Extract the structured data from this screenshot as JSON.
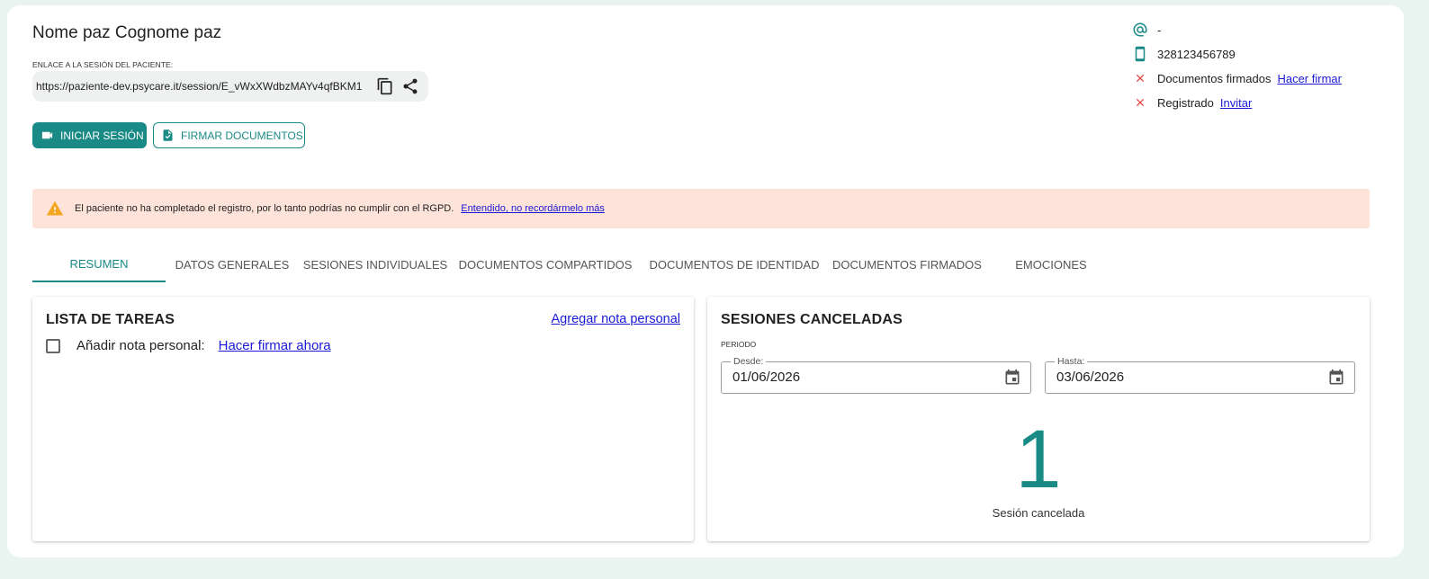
{
  "patient": {
    "name": "Nome paz Cognome paz",
    "link_label": "ENLACE A LA SESIÓN DEL PACIENTE:",
    "link_url": "https://paziente-dev.psycare.it/session/E_vWxXWdbzMAYv4qfBKM1"
  },
  "actions": {
    "start_session": "INICIAR SESIÓN",
    "sign_documents": "FIRMAR DOCUMENTOS"
  },
  "contact": {
    "email": "-",
    "phone": "328123456789",
    "documents_status": "Documentos firmados",
    "documents_action": "Hacer firmar",
    "registered_status": "Registrado",
    "registered_action": "Invitar"
  },
  "alert": {
    "message": "El paciente no ha completado el registro, por lo tanto podrías no cumplir con el RGPD.",
    "dismiss": "Entendido, no recordármelo más"
  },
  "tabs": [
    {
      "label": "RESUMEN"
    },
    {
      "label": "DATOS GENERALES"
    },
    {
      "label": "SESIONES INDIVIDUALES"
    },
    {
      "label": "DOCUMENTOS COMPARTIDOS"
    },
    {
      "label": "DOCUMENTOS DE IDENTIDAD"
    },
    {
      "label": "DOCUMENTOS FIRMADOS"
    },
    {
      "label": "EMOCIONES"
    }
  ],
  "tasks": {
    "title": "LISTA DE TAREAS",
    "add_note": "Agregar nota personal",
    "item_label": "Añadir nota personal:",
    "item_action": "Hacer firmar ahora"
  },
  "cancelled": {
    "title": "SESIONES CANCELADAS",
    "period_label": "PERIODO",
    "from_label": "Desde:",
    "from_value": "01/06/2026",
    "to_label": "Hasta:",
    "to_value": "03/06/2026",
    "count": "1",
    "count_label": "Sesión cancelada"
  },
  "icons": {
    "email": "at-icon",
    "phone": "smartphone-icon",
    "status_missing": "close-icon",
    "copy": "copy-icon",
    "share": "share-icon",
    "video": "videocam-icon",
    "document": "document-sign-icon",
    "warning": "warning-icon",
    "calendar": "calendar-icon"
  },
  "colors": {
    "primary": "#1a8a86",
    "alert_bg": "#fde3d9",
    "warning": "#f5a623",
    "error": "#e53935",
    "link": "#1a1ad6"
  }
}
